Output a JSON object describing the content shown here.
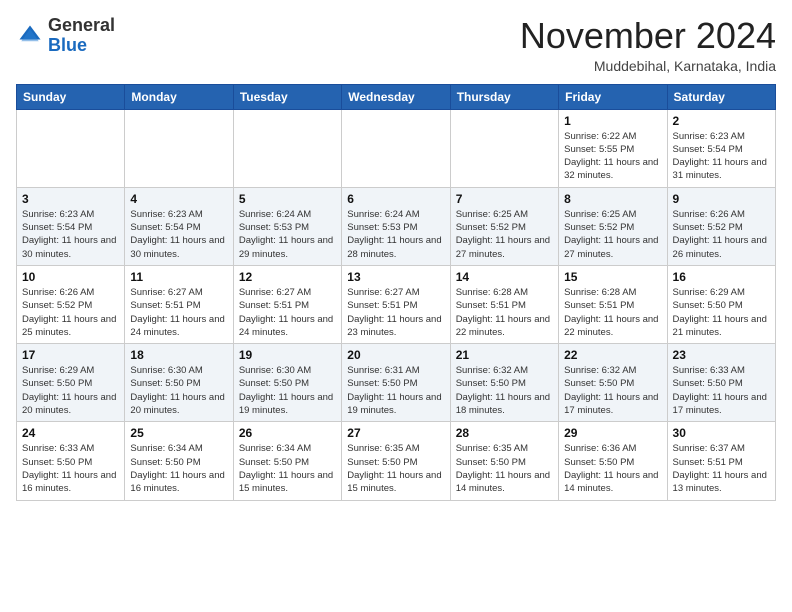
{
  "header": {
    "logo_line1": "General",
    "logo_line2": "Blue",
    "month": "November 2024",
    "location": "Muddebihal, Karnataka, India"
  },
  "weekdays": [
    "Sunday",
    "Monday",
    "Tuesday",
    "Wednesday",
    "Thursday",
    "Friday",
    "Saturday"
  ],
  "weeks": [
    [
      {
        "day": "",
        "sunrise": "",
        "sunset": "",
        "daylight": ""
      },
      {
        "day": "",
        "sunrise": "",
        "sunset": "",
        "daylight": ""
      },
      {
        "day": "",
        "sunrise": "",
        "sunset": "",
        "daylight": ""
      },
      {
        "day": "",
        "sunrise": "",
        "sunset": "",
        "daylight": ""
      },
      {
        "day": "",
        "sunrise": "",
        "sunset": "",
        "daylight": ""
      },
      {
        "day": "1",
        "sunrise": "Sunrise: 6:22 AM",
        "sunset": "Sunset: 5:55 PM",
        "daylight": "Daylight: 11 hours and 32 minutes."
      },
      {
        "day": "2",
        "sunrise": "Sunrise: 6:23 AM",
        "sunset": "Sunset: 5:54 PM",
        "daylight": "Daylight: 11 hours and 31 minutes."
      }
    ],
    [
      {
        "day": "3",
        "sunrise": "Sunrise: 6:23 AM",
        "sunset": "Sunset: 5:54 PM",
        "daylight": "Daylight: 11 hours and 30 minutes."
      },
      {
        "day": "4",
        "sunrise": "Sunrise: 6:23 AM",
        "sunset": "Sunset: 5:54 PM",
        "daylight": "Daylight: 11 hours and 30 minutes."
      },
      {
        "day": "5",
        "sunrise": "Sunrise: 6:24 AM",
        "sunset": "Sunset: 5:53 PM",
        "daylight": "Daylight: 11 hours and 29 minutes."
      },
      {
        "day": "6",
        "sunrise": "Sunrise: 6:24 AM",
        "sunset": "Sunset: 5:53 PM",
        "daylight": "Daylight: 11 hours and 28 minutes."
      },
      {
        "day": "7",
        "sunrise": "Sunrise: 6:25 AM",
        "sunset": "Sunset: 5:52 PM",
        "daylight": "Daylight: 11 hours and 27 minutes."
      },
      {
        "day": "8",
        "sunrise": "Sunrise: 6:25 AM",
        "sunset": "Sunset: 5:52 PM",
        "daylight": "Daylight: 11 hours and 27 minutes."
      },
      {
        "day": "9",
        "sunrise": "Sunrise: 6:26 AM",
        "sunset": "Sunset: 5:52 PM",
        "daylight": "Daylight: 11 hours and 26 minutes."
      }
    ],
    [
      {
        "day": "10",
        "sunrise": "Sunrise: 6:26 AM",
        "sunset": "Sunset: 5:52 PM",
        "daylight": "Daylight: 11 hours and 25 minutes."
      },
      {
        "day": "11",
        "sunrise": "Sunrise: 6:27 AM",
        "sunset": "Sunset: 5:51 PM",
        "daylight": "Daylight: 11 hours and 24 minutes."
      },
      {
        "day": "12",
        "sunrise": "Sunrise: 6:27 AM",
        "sunset": "Sunset: 5:51 PM",
        "daylight": "Daylight: 11 hours and 24 minutes."
      },
      {
        "day": "13",
        "sunrise": "Sunrise: 6:27 AM",
        "sunset": "Sunset: 5:51 PM",
        "daylight": "Daylight: 11 hours and 23 minutes."
      },
      {
        "day": "14",
        "sunrise": "Sunrise: 6:28 AM",
        "sunset": "Sunset: 5:51 PM",
        "daylight": "Daylight: 11 hours and 22 minutes."
      },
      {
        "day": "15",
        "sunrise": "Sunrise: 6:28 AM",
        "sunset": "Sunset: 5:51 PM",
        "daylight": "Daylight: 11 hours and 22 minutes."
      },
      {
        "day": "16",
        "sunrise": "Sunrise: 6:29 AM",
        "sunset": "Sunset: 5:50 PM",
        "daylight": "Daylight: 11 hours and 21 minutes."
      }
    ],
    [
      {
        "day": "17",
        "sunrise": "Sunrise: 6:29 AM",
        "sunset": "Sunset: 5:50 PM",
        "daylight": "Daylight: 11 hours and 20 minutes."
      },
      {
        "day": "18",
        "sunrise": "Sunrise: 6:30 AM",
        "sunset": "Sunset: 5:50 PM",
        "daylight": "Daylight: 11 hours and 20 minutes."
      },
      {
        "day": "19",
        "sunrise": "Sunrise: 6:30 AM",
        "sunset": "Sunset: 5:50 PM",
        "daylight": "Daylight: 11 hours and 19 minutes."
      },
      {
        "day": "20",
        "sunrise": "Sunrise: 6:31 AM",
        "sunset": "Sunset: 5:50 PM",
        "daylight": "Daylight: 11 hours and 19 minutes."
      },
      {
        "day": "21",
        "sunrise": "Sunrise: 6:32 AM",
        "sunset": "Sunset: 5:50 PM",
        "daylight": "Daylight: 11 hours and 18 minutes."
      },
      {
        "day": "22",
        "sunrise": "Sunrise: 6:32 AM",
        "sunset": "Sunset: 5:50 PM",
        "daylight": "Daylight: 11 hours and 17 minutes."
      },
      {
        "day": "23",
        "sunrise": "Sunrise: 6:33 AM",
        "sunset": "Sunset: 5:50 PM",
        "daylight": "Daylight: 11 hours and 17 minutes."
      }
    ],
    [
      {
        "day": "24",
        "sunrise": "Sunrise: 6:33 AM",
        "sunset": "Sunset: 5:50 PM",
        "daylight": "Daylight: 11 hours and 16 minutes."
      },
      {
        "day": "25",
        "sunrise": "Sunrise: 6:34 AM",
        "sunset": "Sunset: 5:50 PM",
        "daylight": "Daylight: 11 hours and 16 minutes."
      },
      {
        "day": "26",
        "sunrise": "Sunrise: 6:34 AM",
        "sunset": "Sunset: 5:50 PM",
        "daylight": "Daylight: 11 hours and 15 minutes."
      },
      {
        "day": "27",
        "sunrise": "Sunrise: 6:35 AM",
        "sunset": "Sunset: 5:50 PM",
        "daylight": "Daylight: 11 hours and 15 minutes."
      },
      {
        "day": "28",
        "sunrise": "Sunrise: 6:35 AM",
        "sunset": "Sunset: 5:50 PM",
        "daylight": "Daylight: 11 hours and 14 minutes."
      },
      {
        "day": "29",
        "sunrise": "Sunrise: 6:36 AM",
        "sunset": "Sunset: 5:50 PM",
        "daylight": "Daylight: 11 hours and 14 minutes."
      },
      {
        "day": "30",
        "sunrise": "Sunrise: 6:37 AM",
        "sunset": "Sunset: 5:51 PM",
        "daylight": "Daylight: 11 hours and 13 minutes."
      }
    ]
  ]
}
